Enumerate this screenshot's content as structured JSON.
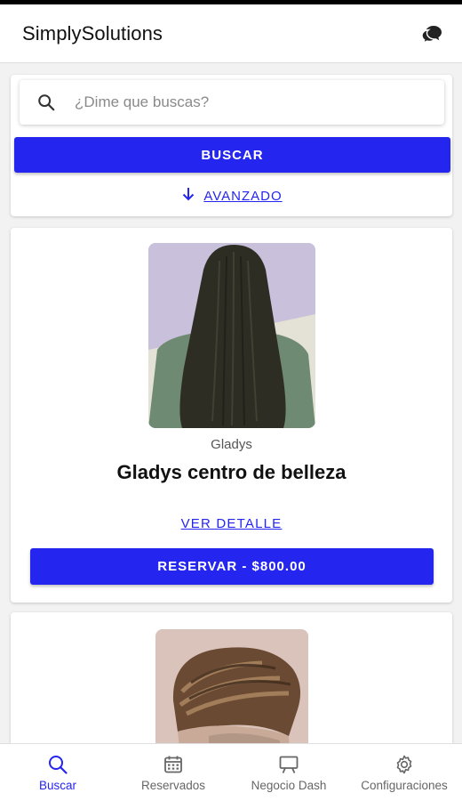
{
  "app": {
    "title": "SimplySolutions",
    "chat_icon": "chat-bubbles-icon"
  },
  "colors": {
    "primary": "#2525f0",
    "inactive": "#666666",
    "background": "#f2f2f2"
  },
  "search": {
    "placeholder": "¿Dime que buscas?",
    "value": "",
    "icon": "search-icon",
    "button_label": "BUSCAR",
    "advanced_label": "AVANZADO",
    "advanced_icon": "arrow-down-icon"
  },
  "results": [
    {
      "provider": "Gladys",
      "title": "Gladys centro de belleza",
      "detail_label": "VER DETALLE",
      "reserve_label": "RESERVAR - $800.00",
      "image": "long-straight-hair-photo"
    },
    {
      "image": "mens-haircut-photo"
    }
  ],
  "bottom_nav": [
    {
      "label": "Buscar",
      "icon": "search-icon",
      "active": true
    },
    {
      "label": "Reservados",
      "icon": "calendar-icon",
      "active": false
    },
    {
      "label": "Negocio Dash",
      "icon": "easel-icon",
      "active": false
    },
    {
      "label": "Configuraciones",
      "icon": "gear-icon",
      "active": false
    }
  ]
}
